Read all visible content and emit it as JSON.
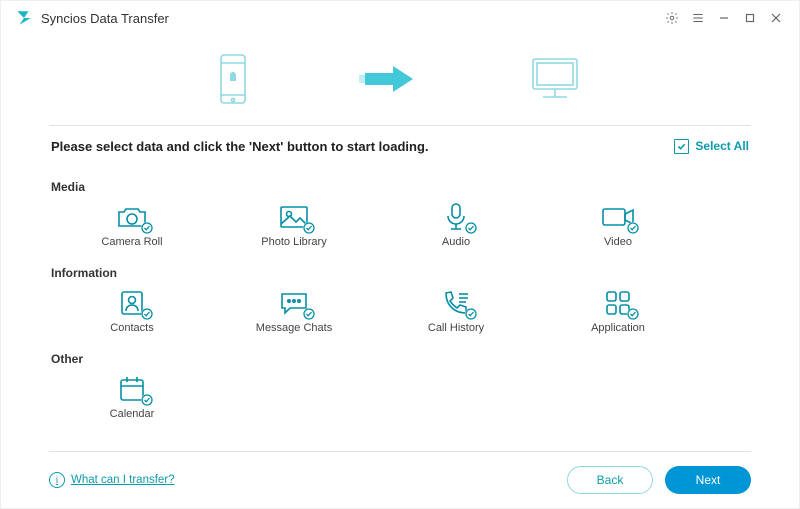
{
  "titlebar": {
    "app_name": "Syncios Data Transfer"
  },
  "instruction": "Please select data and click the 'Next' button to start loading.",
  "select_all_label": "Select All",
  "sections": {
    "media": {
      "title": "Media",
      "items": {
        "camera_roll": "Camera Roll",
        "photo_library": "Photo Library",
        "audio": "Audio",
        "video": "Video"
      }
    },
    "information": {
      "title": "Information",
      "items": {
        "contacts": "Contacts",
        "message_chats": "Message Chats",
        "call_history": "Call History",
        "application": "Application"
      }
    },
    "other": {
      "title": "Other",
      "items": {
        "calendar": "Calendar"
      }
    }
  },
  "footer": {
    "help_link": "What can I transfer?",
    "back": "Back",
    "next": "Next"
  },
  "colors": {
    "accent": "#1bb5c4",
    "primary_button": "#0096d6"
  }
}
